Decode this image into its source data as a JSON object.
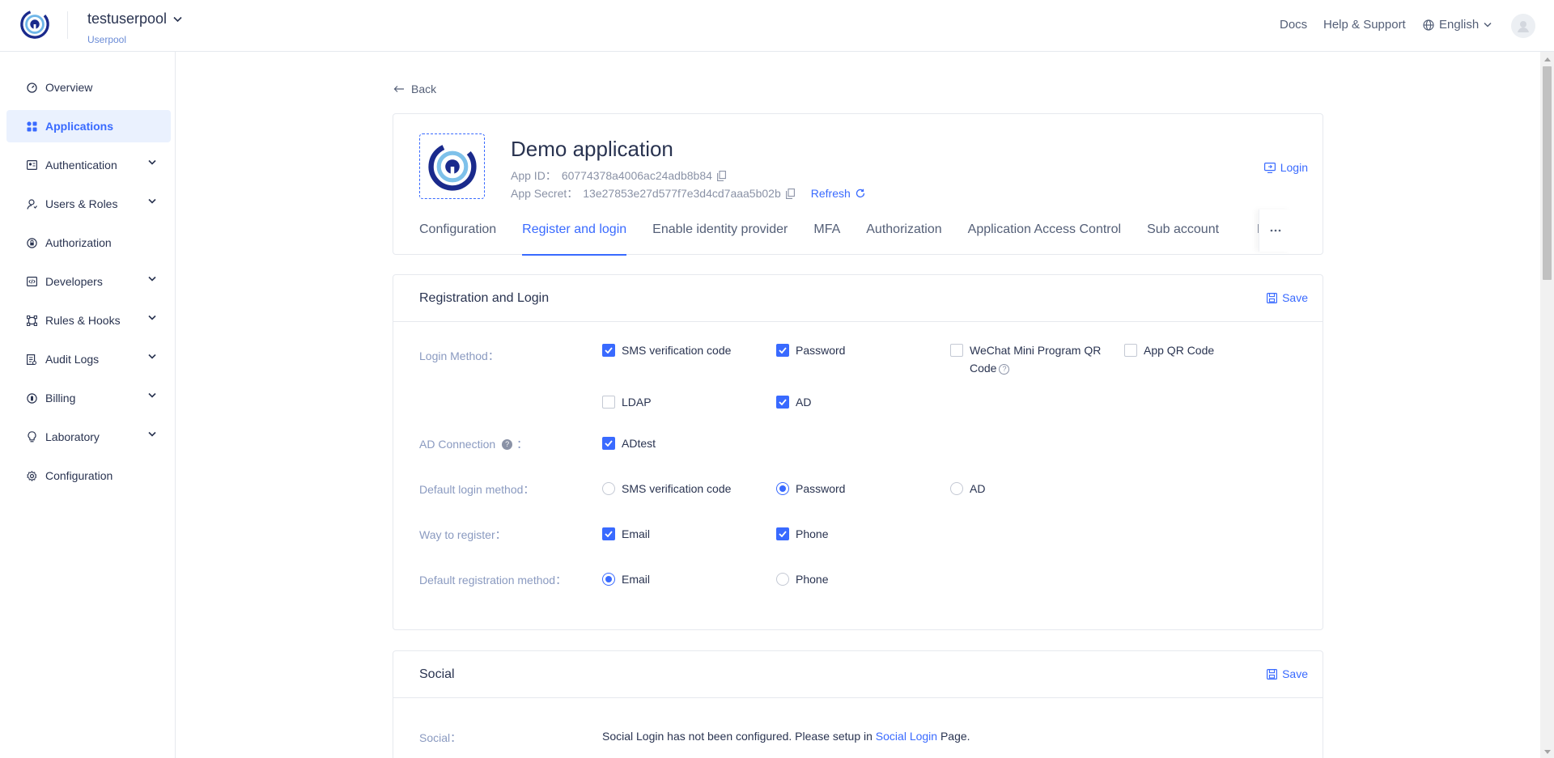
{
  "header": {
    "pool_name": "testuserpool",
    "pool_sub": "Userpool",
    "docs": "Docs",
    "help": "Help & Support",
    "language": "English"
  },
  "sidebar": {
    "items": [
      {
        "label": "Overview",
        "icon": "dashboard-icon"
      },
      {
        "label": "Applications",
        "icon": "apps-icon"
      },
      {
        "label": "Authentication",
        "icon": "id-card-icon"
      },
      {
        "label": "Users & Roles",
        "icon": "user-icon"
      },
      {
        "label": "Authorization",
        "icon": "lock-icon"
      },
      {
        "label": "Developers",
        "icon": "code-icon"
      },
      {
        "label": "Rules & Hooks",
        "icon": "hook-icon"
      },
      {
        "label": "Audit Logs",
        "icon": "log-icon"
      },
      {
        "label": "Billing",
        "icon": "billing-icon"
      },
      {
        "label": "Laboratory",
        "icon": "bulb-icon"
      },
      {
        "label": "Configuration",
        "icon": "gear-icon"
      }
    ]
  },
  "back": "Back",
  "app": {
    "title": "Demo application",
    "app_id_label": "App ID：",
    "app_id": "60774378a4006ac24adb8b84",
    "secret_label": "App Secret：",
    "secret": "13e27853e27d577f7e3d4cd7aaa5b02b",
    "refresh": "Refresh",
    "login": "Login"
  },
  "tabs": [
    "Configuration",
    "Register and login",
    "Enable identity provider",
    "MFA",
    "Authorization",
    "Application Access Control",
    "Sub account"
  ],
  "tab_clipped": "Lo",
  "registration": {
    "title": "Registration and Login",
    "save": "Save",
    "login_method_label": "Login Method：",
    "login_methods": [
      {
        "label": "SMS verification code",
        "checked": true
      },
      {
        "label": "Password",
        "checked": true
      },
      {
        "label": "WeChat Mini Program QR Code",
        "checked": false
      },
      {
        "label": "App QR Code",
        "checked": false
      },
      {
        "label": "LDAP",
        "checked": false
      },
      {
        "label": "AD",
        "checked": true
      }
    ],
    "ad_connection_label": "AD Connection",
    "ad_connection": {
      "label": "ADtest",
      "checked": true
    },
    "default_login_label": "Default login method：",
    "default_login": [
      {
        "label": "SMS verification code",
        "selected": false
      },
      {
        "label": "Password",
        "selected": true
      },
      {
        "label": "AD",
        "selected": false
      }
    ],
    "way_register_label": "Way to register：",
    "way_register": [
      {
        "label": "Email",
        "checked": true
      },
      {
        "label": "Phone",
        "checked": true
      }
    ],
    "default_reg_label": "Default registration method：",
    "default_reg": [
      {
        "label": "Email",
        "selected": true
      },
      {
        "label": "Phone",
        "selected": false
      }
    ]
  },
  "social": {
    "title": "Social",
    "save": "Save",
    "label": "Social：",
    "text_before": "Social Login has not been configured. Please setup in ",
    "link": "Social Login",
    "text_after": " Page."
  },
  "colors": {
    "accent": "#396aff",
    "text": "#293350",
    "label": "#8a9ac0"
  }
}
